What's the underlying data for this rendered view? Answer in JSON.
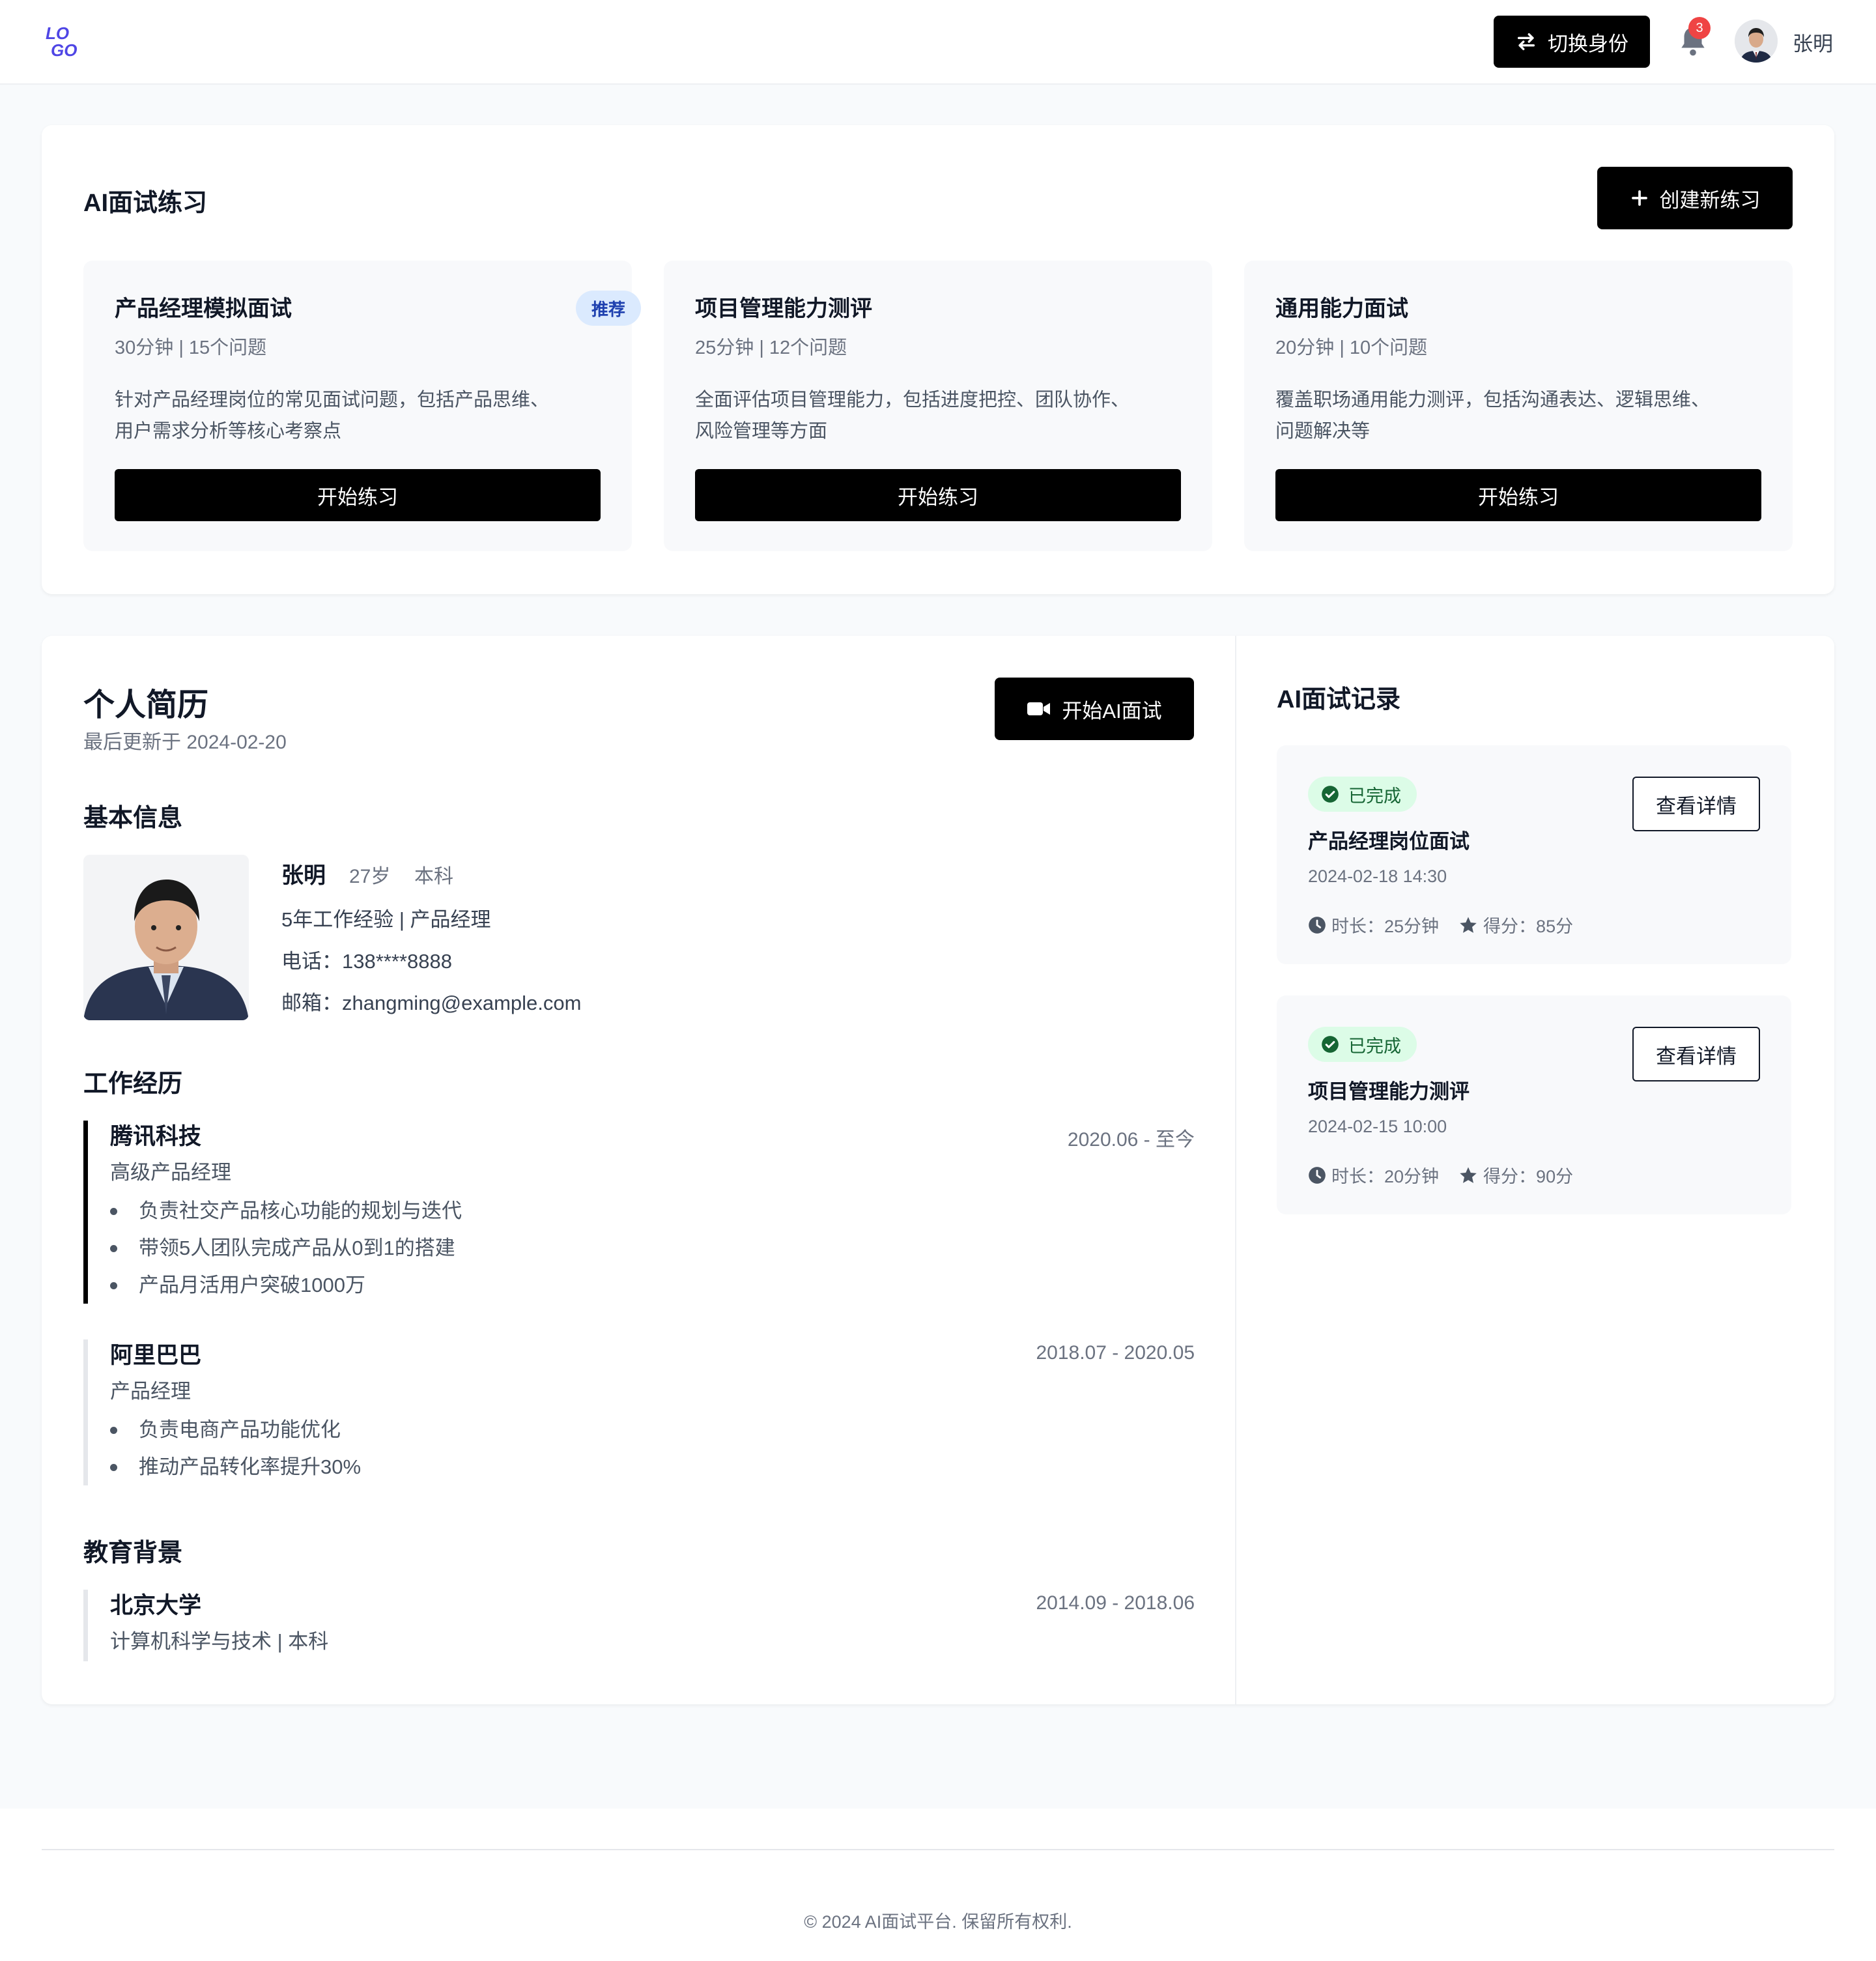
{
  "header": {
    "logo_text": "LOGO",
    "switch_label": "切换身份",
    "notification_count": "3",
    "user_name": "张明"
  },
  "practice": {
    "title": "AI面试练习",
    "create_label": "创建新练习",
    "items": [
      {
        "title": "产品经理模拟面试",
        "tag": "推荐",
        "meta": "30分钟 | 15个问题",
        "desc_line1": "针对产品经理岗位的常见面试问题，包括产品思维、",
        "desc_line2": "用户需求分析等核心考察点",
        "button": "开始练习"
      },
      {
        "title": "项目管理能力测评",
        "meta": "25分钟 | 12个问题",
        "desc_line1": "全面评估项目管理能力，包括进度把控、团队协作、",
        "desc_line2": "风险管理等方面",
        "button": "开始练习"
      },
      {
        "title": "通用能力面试",
        "meta": "20分钟 | 10个问题",
        "desc_line1": "覆盖职场通用能力测评，包括沟通表达、逻辑思维、",
        "desc_line2": "问题解决等",
        "button": "开始练习"
      }
    ]
  },
  "resume": {
    "title": "个人简历",
    "updated": "最后更新于 2024-02-20",
    "start_ai_label": "开始AI面试",
    "basic": {
      "title": "基本信息",
      "name": "张明",
      "age": "27岁",
      "degree": "本科",
      "experience": "5年工作经验 | 产品经理",
      "phone": "电话：138****8888",
      "email": "邮箱：zhangming@example.com"
    },
    "work": {
      "title": "工作经历",
      "items": [
        {
          "company": "腾讯科技",
          "role": "高级产品经理",
          "date": "2020.06 - 至今",
          "bullets": [
            "负责社交产品核心功能的规划与迭代",
            "带领5人团队完成产品从0到1的搭建",
            "产品月活用户突破1000万"
          ]
        },
        {
          "company": "阿里巴巴",
          "role": "产品经理",
          "date": "2018.07 - 2020.05",
          "bullets": [
            "负责电商产品功能优化",
            "推动产品转化率提升30%"
          ]
        }
      ]
    },
    "education": {
      "title": "教育背景",
      "school": "北京大学",
      "major": "计算机科学与技术 | 本科",
      "date": "2014.09 - 2018.06"
    }
  },
  "records": {
    "title": "AI面试记录",
    "items": [
      {
        "status": "已完成",
        "name": "产品经理岗位面试",
        "time": "2024-02-18 14:30",
        "duration": "时长：25分钟",
        "score": "得分：85分",
        "detail": "查看详情"
      },
      {
        "status": "已完成",
        "name": "项目管理能力测评",
        "time": "2024-02-15 10:00",
        "duration": "时长：20分钟",
        "score": "得分：90分",
        "detail": "查看详情"
      }
    ]
  },
  "footer": {
    "text": "© 2024 AI面试平台. 保留所有权利."
  },
  "colors": {
    "accent": "#000000",
    "logo": "#4f46e5",
    "badge": "#ef4444",
    "success_bg": "#dcfce7",
    "success_text": "#166534",
    "tag_bg": "#dbeafe",
    "tag_text": "#1e40af"
  }
}
